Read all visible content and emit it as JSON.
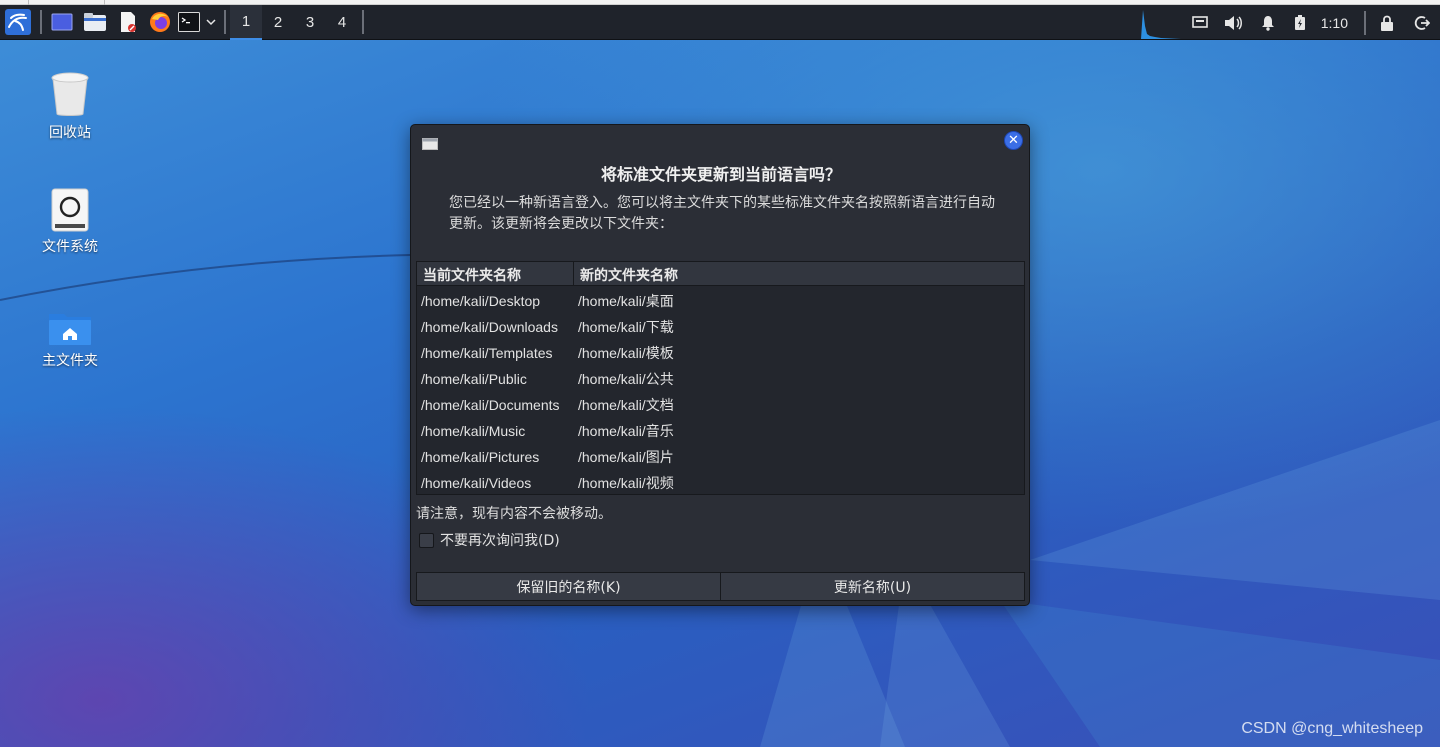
{
  "panel": {
    "workspaces": [
      "1",
      "2",
      "3",
      "4"
    ],
    "active_workspace": "1",
    "clock": "1:10",
    "accent": "#3e8ee8"
  },
  "desktop": {
    "icons": [
      {
        "label": "回收站",
        "icon": "trash-icon"
      },
      {
        "label": "文件系统",
        "icon": "filesystem-drive-icon"
      },
      {
        "label": "主文件夹",
        "icon": "home-folder-icon"
      }
    ]
  },
  "dialog": {
    "title": "将标准文件夹更新到当前语言吗？",
    "description": "您已经以一种新语言登入。您可以将主文件夹下的某些标准文件夹名按照新语言进行自动更新。该更新将会更改以下文件夹：",
    "columns": [
      "当前文件夹名称",
      "新的文件夹名称"
    ],
    "rows": [
      [
        "/home/kali/Desktop",
        "/home/kali/桌面"
      ],
      [
        "/home/kali/Downloads",
        "/home/kali/下载"
      ],
      [
        "/home/kali/Templates",
        "/home/kali/模板"
      ],
      [
        "/home/kali/Public",
        "/home/kali/公共"
      ],
      [
        "/home/kali/Documents",
        "/home/kali/文档"
      ],
      [
        "/home/kali/Music",
        "/home/kali/音乐"
      ],
      [
        "/home/kali/Pictures",
        "/home/kali/图片"
      ],
      [
        "/home/kali/Videos",
        "/home/kali/视频"
      ]
    ],
    "note": "请注意，现有内容不会被移动。",
    "checkbox_label": "不要再次询问我(D)",
    "checkbox_checked": false,
    "keep_button": "保留旧的名称(K)",
    "update_button": "更新名称(U)",
    "close_accent": "#3b6ee6"
  },
  "watermark": "CSDN @cng_whitesheep"
}
